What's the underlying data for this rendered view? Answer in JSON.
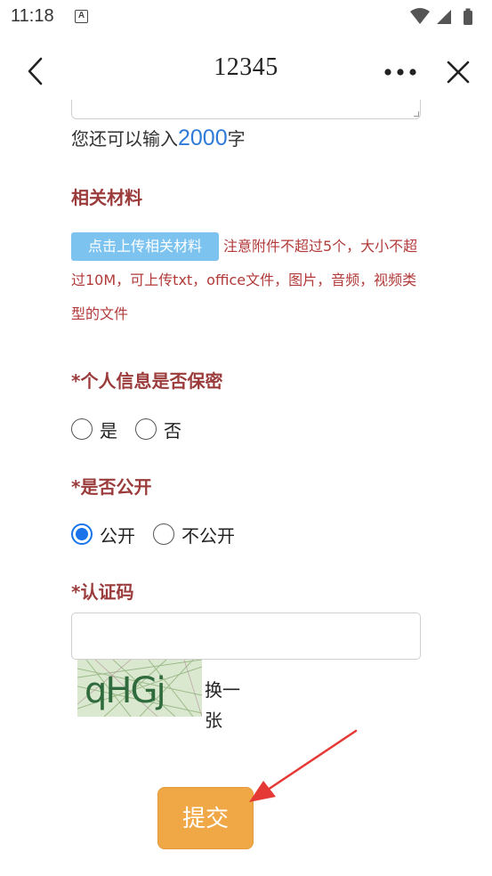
{
  "status_bar": {
    "time": "11:18",
    "notification_badge": "A"
  },
  "nav": {
    "title": "12345"
  },
  "form": {
    "char_prefix": "您还可以输入",
    "char_count": "2000",
    "char_suffix": "字",
    "materials": {
      "title": "相关材料",
      "upload_label": "点击上传相关材料",
      "note": "注意附件不超过5个，大小不超过10M，可上传txt，office文件，图片，音频，视频类型的文件"
    },
    "privacy": {
      "title": "*个人信息是否保密",
      "options": [
        "是",
        "否"
      ],
      "selected": null
    },
    "public": {
      "title": "*是否公开",
      "options": [
        "公开",
        "不公开"
      ],
      "selected": "公开"
    },
    "captcha": {
      "title": "*认证码",
      "input_value": "",
      "image_text": "qHGj",
      "refresh_label": "换一张"
    },
    "submit_label": "提交"
  },
  "colors": {
    "accent": "#1a73e8",
    "section_title": "#9b3b3b",
    "note_text": "#b23a3a",
    "upload_button": "#7cc3f0",
    "submit_button": "#f0a847",
    "annotation_arrow": "#e53935"
  },
  "icons": {
    "back": "chevron-left-icon",
    "more": "more-dots-icon",
    "close": "close-icon",
    "wifi": "wifi-icon",
    "signal": "signal-icon",
    "battery": "battery-icon"
  }
}
